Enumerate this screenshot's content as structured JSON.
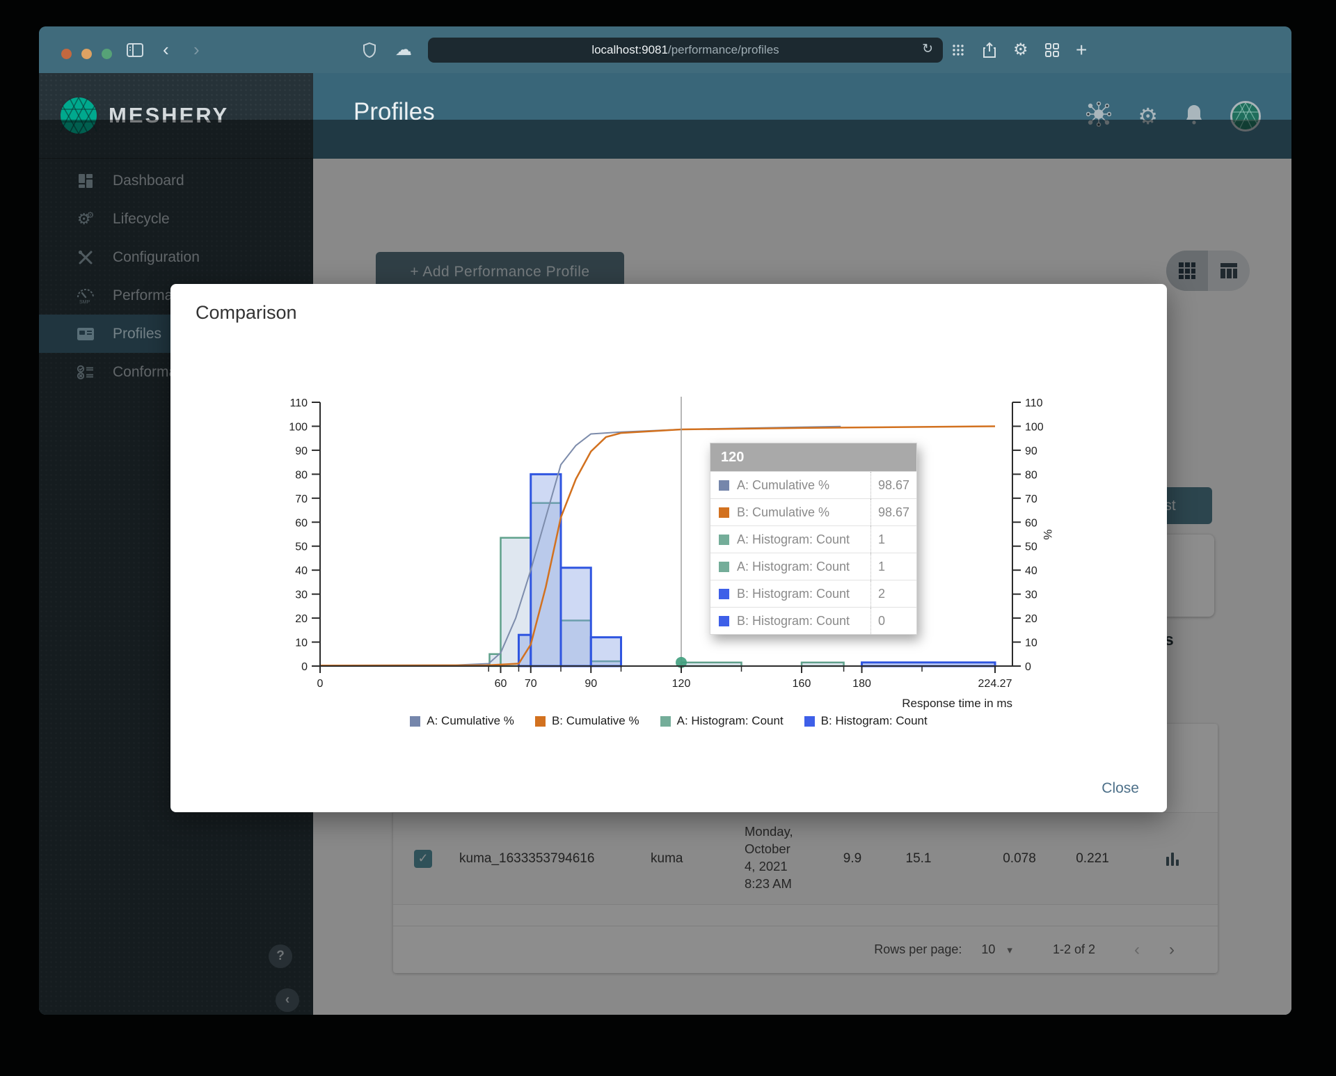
{
  "browser": {
    "url_host": "localhost:9081",
    "url_path": "/performance/profiles",
    "traffic_lights": [
      "#c3683f",
      "#dda263",
      "#56a277"
    ],
    "reload_glyph": "↻"
  },
  "sidebar": {
    "brand": "MESHERY",
    "items": [
      {
        "label": "Dashboard"
      },
      {
        "label": "Lifecycle"
      },
      {
        "label": "Configuration"
      },
      {
        "label": "Performance"
      },
      {
        "label": "Profiles",
        "active": true
      },
      {
        "label": "Conformance"
      }
    ],
    "help_glyph": "?",
    "collapse_glyph": "‹"
  },
  "header": {
    "title": "Profiles"
  },
  "toolbar": {
    "add_profile_label": "+ Add Performance Profile"
  },
  "profile_panel": {
    "run_test_label": "Run Test",
    "back_arrow": "←",
    "details_label": "Details"
  },
  "table": {
    "row": {
      "name": "kuma_1633353794616",
      "mesh": "kuma",
      "date_lines": [
        "Monday,",
        "October",
        "4, 2021",
        "8:23 AM"
      ],
      "qps": "9.9",
      "duration": "15.1",
      "p50": "0.078",
      "p99": "0.221",
      "checkmark": "✓"
    },
    "pagination": {
      "rows_per_page_label": "Rows per page:",
      "rows_per_page_value": "10",
      "caret": "▾",
      "range": "1-2 of 2",
      "prev": "‹",
      "next": "›"
    }
  },
  "modal": {
    "title": "Comparison",
    "close_label": "Close"
  },
  "tooltip": {
    "header": "120",
    "rows": [
      {
        "label": "A: Cumulative %",
        "value": "98.67",
        "color": "#7586ab"
      },
      {
        "label": "B: Cumulative %",
        "value": "98.67",
        "color": "#d2711f"
      },
      {
        "label": "A: Histogram: Count",
        "value": "1",
        "color": "#74ad99"
      },
      {
        "label": "A: Histogram: Count",
        "value": "1",
        "color": "#74ad99"
      },
      {
        "label": "B: Histogram: Count",
        "value": "2",
        "color": "#3e5fe8"
      },
      {
        "label": "B: Histogram: Count",
        "value": "0",
        "color": "#3e5fe8"
      }
    ]
  },
  "legend": [
    {
      "label": "A: Cumulative %",
      "color": "#7586ab"
    },
    {
      "label": "B: Cumulative %",
      "color": "#d2711f"
    },
    {
      "label": "A: Histogram: Count",
      "color": "#74ad99"
    },
    {
      "label": "B: Histogram: Count",
      "color": "#3e5fe8"
    }
  ],
  "chart_data": {
    "type": "histogram+cumulative-line",
    "title": "Comparison",
    "xlabel": "Response time in ms",
    "ylabel_right": "%",
    "x_max": 224.27,
    "ylim": [
      0,
      110
    ],
    "y_tick_step": 10,
    "x_ticks_labeled": [
      0,
      60,
      70,
      90,
      120,
      160,
      180,
      224.27
    ],
    "x_ticks_minor": [
      56,
      66,
      80,
      100,
      140,
      174,
      200
    ],
    "series": [
      {
        "name": "A: Cumulative %",
        "type": "line",
        "color": "#7d8cab",
        "width": 2,
        "points": [
          [
            0,
            0.3
          ],
          [
            45,
            0.4
          ],
          [
            56,
            1
          ],
          [
            60,
            5.5
          ],
          [
            65,
            20
          ],
          [
            70,
            40
          ],
          [
            75,
            62
          ],
          [
            80,
            84
          ],
          [
            85,
            92
          ],
          [
            90,
            96.8
          ],
          [
            100,
            97.6
          ],
          [
            120,
            98.67
          ],
          [
            140,
            99.2
          ],
          [
            173,
            99.9
          ]
        ]
      },
      {
        "name": "B: Cumulative %",
        "type": "line",
        "color": "#d2711f",
        "width": 2.5,
        "points": [
          [
            0,
            0.2
          ],
          [
            55,
            0.3
          ],
          [
            66,
            1
          ],
          [
            70,
            9
          ],
          [
            75,
            33
          ],
          [
            80,
            62
          ],
          [
            85,
            78
          ],
          [
            90,
            89.5
          ],
          [
            95,
            95.5
          ],
          [
            100,
            97.2
          ],
          [
            120,
            98.67
          ],
          [
            160,
            99.3
          ],
          [
            180,
            99.5
          ],
          [
            224.27,
            100
          ]
        ]
      },
      {
        "name": "A: Histogram: Count",
        "type": "histogram",
        "color": "#5fa18b",
        "width": 2.5,
        "fill": "rgba(196,212,228,0.55)",
        "bars": [
          [
            56.3,
            60,
            5
          ],
          [
            60,
            70,
            53.5
          ],
          [
            70,
            80,
            68
          ],
          [
            80,
            90,
            19
          ],
          [
            90,
            100,
            2
          ],
          [
            120,
            140,
            1.5
          ],
          [
            160,
            174,
            1.5
          ]
        ]
      },
      {
        "name": "B: Histogram: Count",
        "type": "histogram",
        "color": "#2f55e0",
        "width": 3,
        "fill": "rgba(125,155,225,0.38)",
        "bars": [
          [
            66,
            70,
            13
          ],
          [
            70,
            80,
            80
          ],
          [
            80,
            90,
            41
          ],
          [
            90,
            100,
            12
          ],
          [
            180,
            224.27,
            1.5
          ]
        ]
      }
    ],
    "hover": {
      "x": 120,
      "marker_y": 1.5,
      "marker_color": "#3f9e7d",
      "line_color": "#a0a0a0"
    }
  }
}
